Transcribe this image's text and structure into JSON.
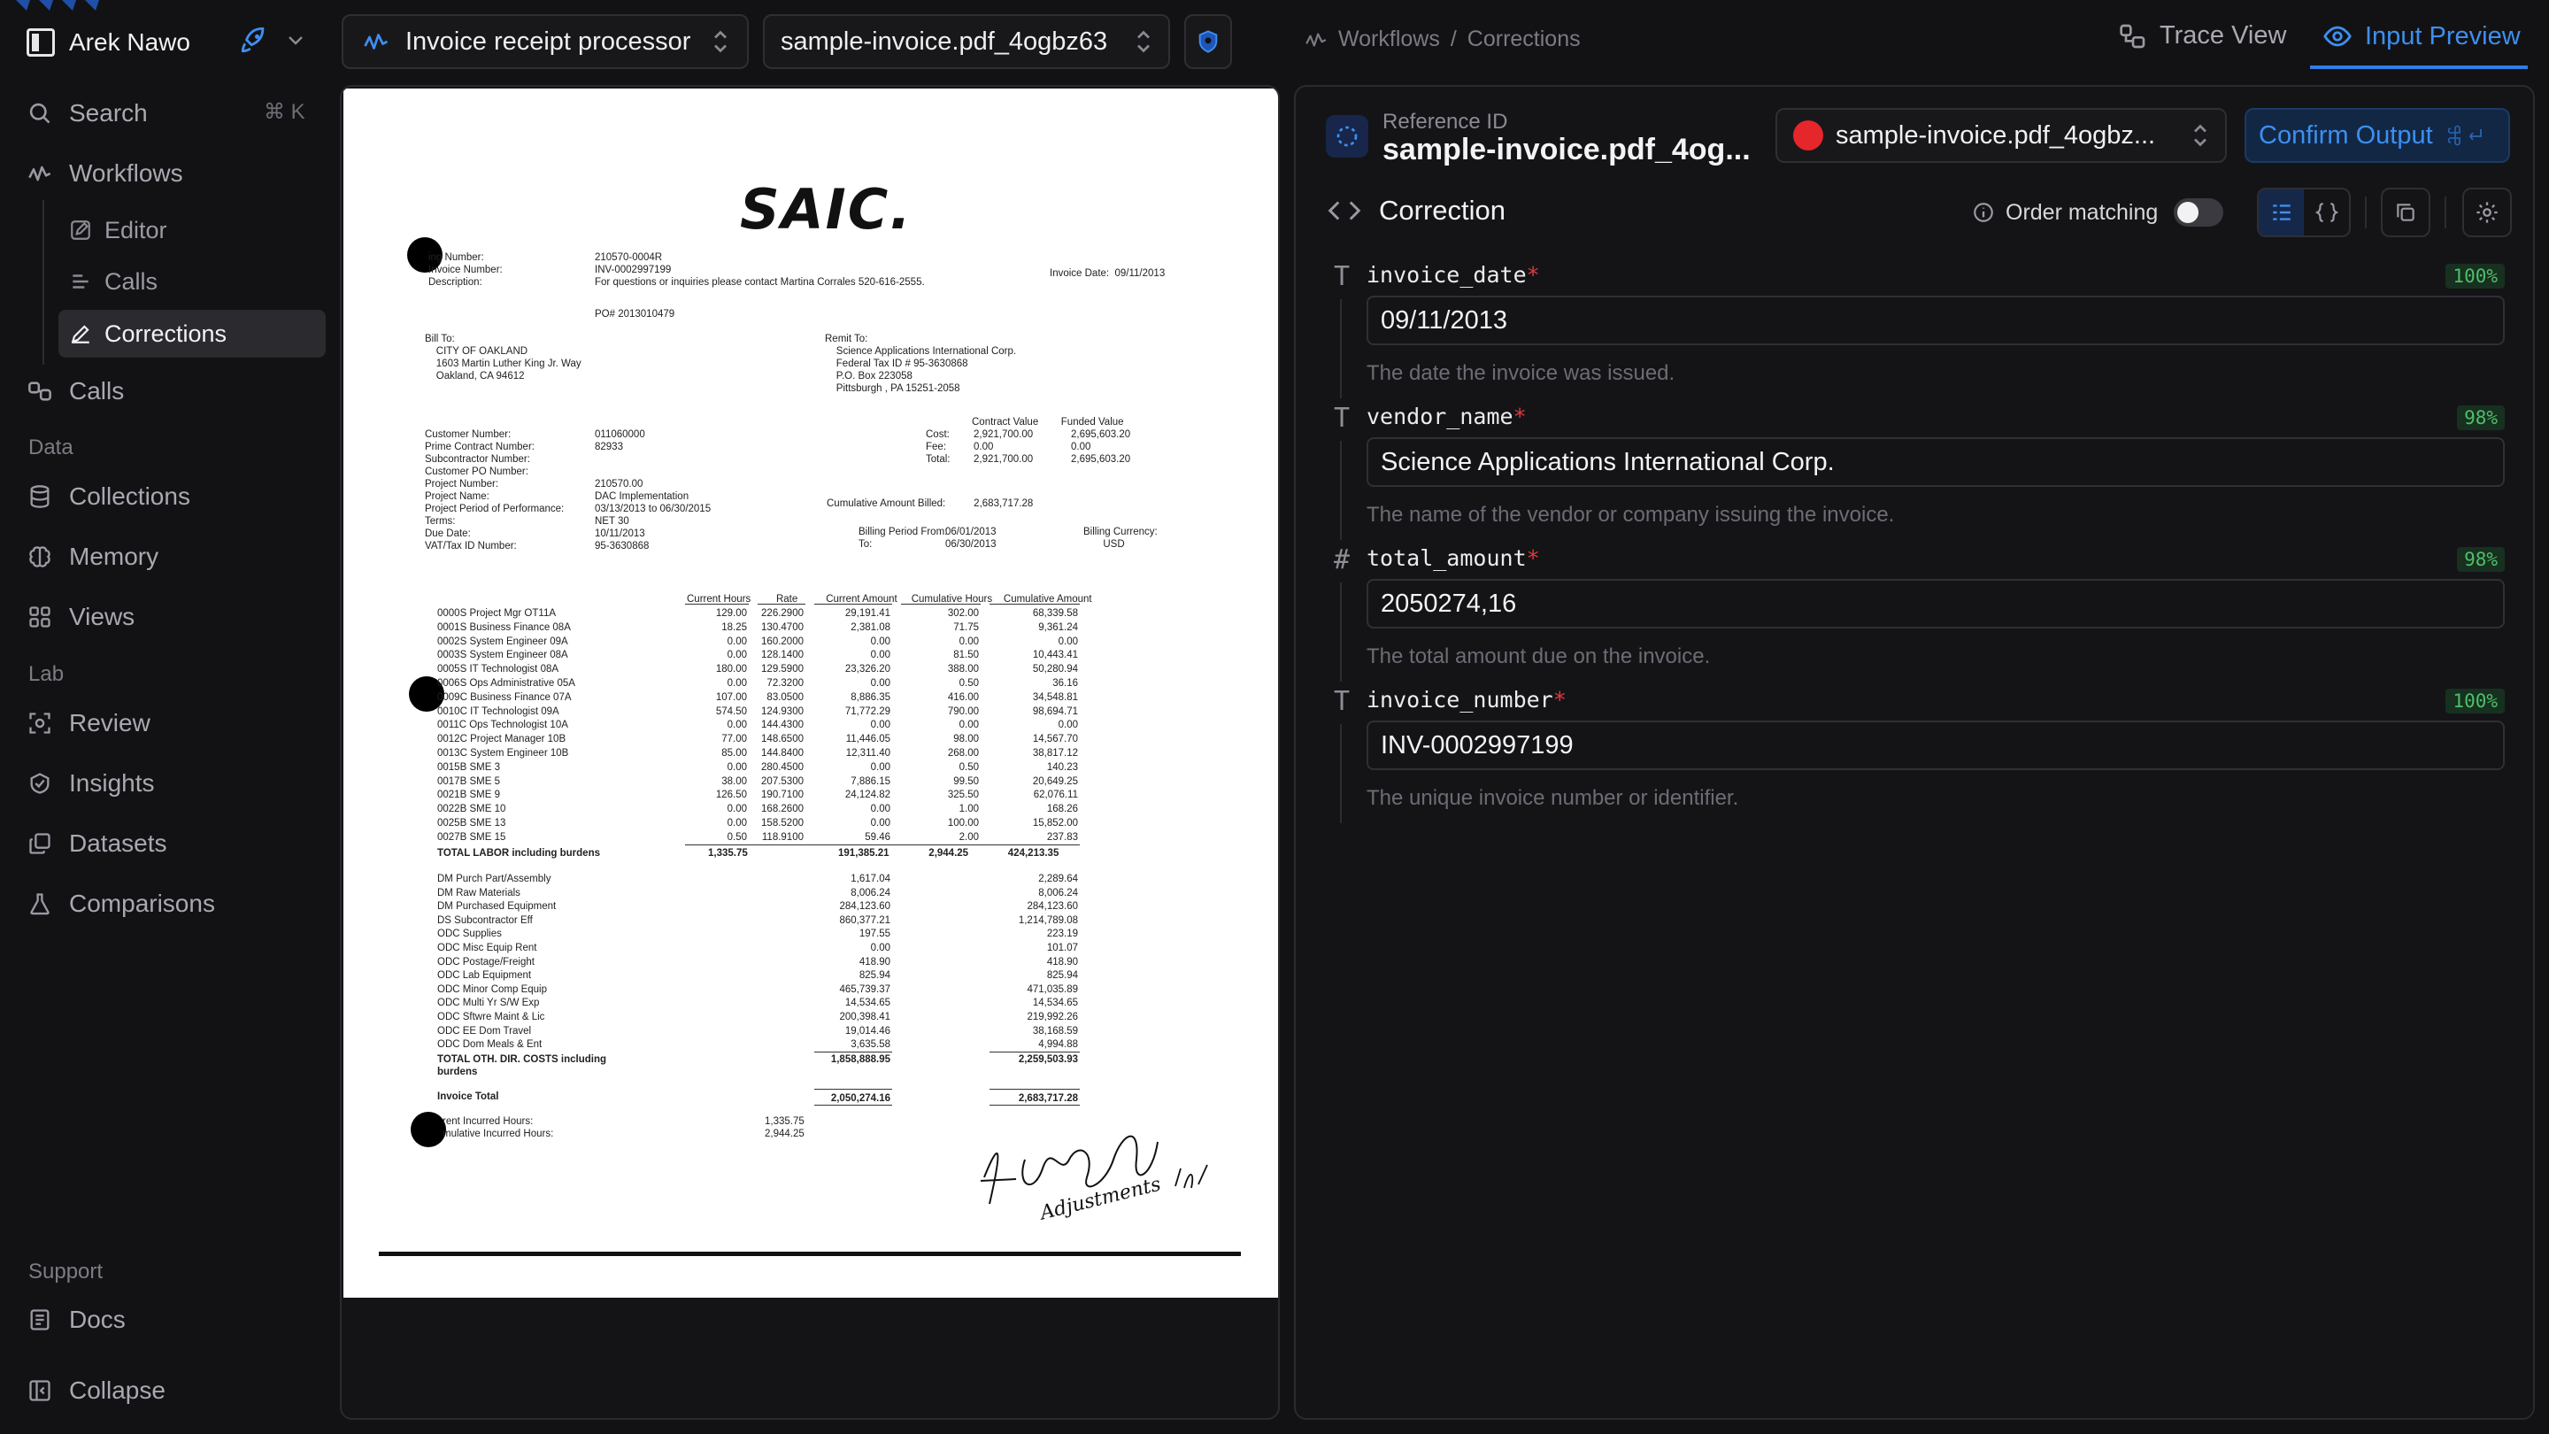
{
  "sidebar": {
    "workspace_name": "Arek Nawo",
    "search": {
      "label": "Search",
      "shortcut": "⌘ K"
    },
    "workflows_label": "Workflows",
    "workflow_items": [
      {
        "label": "Editor"
      },
      {
        "label": "Calls"
      },
      {
        "label": "Corrections"
      }
    ],
    "calls_label": "Calls",
    "data_section": "Data",
    "data_items": [
      {
        "label": "Collections"
      },
      {
        "label": "Memory"
      },
      {
        "label": "Views"
      }
    ],
    "lab_section": "Lab",
    "lab_items": [
      {
        "label": "Review"
      },
      {
        "label": "Insights"
      },
      {
        "label": "Datasets"
      },
      {
        "label": "Comparisons"
      }
    ],
    "support_section": "Support",
    "docs_label": "Docs",
    "collapse_label": "Collapse"
  },
  "topbar": {
    "processor": "Invoice receipt processor",
    "file": "sample-invoice.pdf_4ogbz63",
    "breadcrumb": [
      "Workflows",
      "/",
      "Corrections"
    ],
    "tabs": [
      {
        "label": "Trace View",
        "active": false
      },
      {
        "label": "Input Preview",
        "active": true
      }
    ]
  },
  "document": {
    "logo": "SAIC.",
    "header_labels": "ing Number:\nInvoice Number:\nDescription:",
    "header_values": "210570-0004R\nINV-0002997199\nFor questions or inquiries please contact Martina Corrales 520-616-2555.",
    "invoice_date": "Invoice Date:  09/11/2013",
    "po": "PO# 2013010479",
    "bill_to": "Bill To:\n    CITY OF OAKLAND\n    1603 Martin Luther King Jr. Way\n    Oakland, CA 94612",
    "remit_to": "Remit To:\n    Science Applications International Corp.\n    Federal Tax ID # 95-3630868\n    P.O. Box 223058\n    Pittsburgh , PA 15251-2058",
    "cust_labels": "Customer Number:\nPrime Contract Number:\nSubcontractor Number:\nCustomer PO Number:\nProject Number:\nProject Name:\nProject Period of Performance:\nTerms:\nDue Date:\nVAT/Tax ID Number:",
    "cust_values": "011060000\n82933\n\n\n210570.00\nDAC Implementation\n03/13/2013 to 06/30/2015\nNET 30\n10/11/2013\n95-3630868",
    "contract_header": "Contract Value        Funded Value",
    "contract_labels": "Cost:\nFee:\nTotal:",
    "contract_values": "2,921,700.00\n0.00\n2,921,700.00",
    "funded_values": "2,695,603.20\n0.00\n2,695,603.20",
    "cum_billed": "Cumulative Amount Billed:          2,683,717.28",
    "billing_period": "Billing Period From:\nTo:",
    "billing_dates": "06/01/2013\n06/30/2013",
    "billing_currency": "Billing Currency:\n       USD",
    "col_headers": "Current Hours         Rate          Current Amount     Cumulative Hours    Cumulative Amount",
    "labor_names": "0000S Project Mgr OT11A\n0001S Business Finance 08A\n0002S System Engineer 09A\n0003S System Engineer 08A\n0005S IT Technologist 08A\n0006S Ops Administrative 05A\n0009C Business Finance 07A\n0010C IT Technologist 09A\n0011C Ops Technologist 10A\n0012C Project Manager 10B\n0013C System Engineer 10B\n0015B SME 3\n0017B SME 5\n0021B SME 9\n0022B SME 10\n0025B SME 13\n0027B SME 15",
    "labor_hours": "129.00\n18.25\n0.00\n0.00\n180.00\n0.00\n107.00\n574.50\n0.00\n77.00\n85.00\n0.00\n38.00\n126.50\n0.00\n0.00\n0.50",
    "labor_rates": "226.2900\n130.4700\n160.2000\n128.1400\n129.5900\n72.3200\n83.0500\n124.9300\n144.4300\n148.6500\n144.8400\n280.4500\n207.5300\n190.7100\n168.2600\n158.5200\n118.9100",
    "labor_amounts": "29,191.41\n2,381.08\n0.00\n0.00\n23,326.20\n0.00\n8,886.35\n71,772.29\n0.00\n11,446.05\n12,311.40\n0.00\n7,886.15\n24,124.82\n0.00\n0.00\n59.46",
    "labor_cum_hours": "302.00\n71.75\n0.00\n81.50\n388.00\n0.50\n416.00\n790.00\n0.00\n98.00\n268.00\n0.50\n99.50\n325.50\n1.00\n100.00\n2.00",
    "labor_cum_amounts": "68,339.58\n9,361.24\n0.00\n10,443.41\n50,280.94\n36.16\n34,548.81\n98,694.71\n0.00\n14,567.70\n38,817.12\n140.23\n20,649.25\n62,076.11\n168.26\n15,852.00\n237.83",
    "labor_total_label": "TOTAL LABOR including burdens",
    "labor_total_values": "1,335.75                                191,385.21              2,944.25              424,213.35",
    "odc_names": "DM Purch Part/Assembly\nDM Raw Materials\nDM Purchased Equipment\nDS Subcontractor Eff\nODC Supplies\nODC Misc Equip Rent\nODC Postage/Freight\nODC Lab Equipment\nODC Minor Comp Equip\nODC Multi Yr S/W Exp\nODC Sftwre Maint & Lic\nODC EE Dom Travel\nODC Dom Meals & Ent",
    "odc_amounts": "1,617.04\n8,006.24\n284,123.60\n860,377.21\n197.55\n0.00\n418.90\n825.94\n465,739.37\n14,534.65\n200,398.41\n19,014.46\n3,635.58",
    "odc_cum": "2,289.64\n8,006.24\n284,123.60\n1,214,789.08\n223.19\n101.07\n418.90\n825.94\n471,035.89\n14,534.65\n219,992.26\n38,168.59\n4,994.88",
    "odc_total_label": "TOTAL OTH. DIR. COSTS including\nburdens",
    "odc_total_amount": "1,858,888.95",
    "odc_total_cum": "2,259,503.93",
    "invoice_total_label": "Invoice Total",
    "invoice_total_amount": "2,050,274.16",
    "invoice_total_cum": "2,683,717.28",
    "incurred_labels": "rent Incurred Hours:\nmulative Incurred Hours:",
    "incurred_values": "1,335.75\n2,944.25",
    "handwritten": "Adjustments"
  },
  "panel": {
    "ref_label": "Reference ID",
    "ref_value": "sample-invoice.pdf_4og...",
    "file_select": "sample-invoice.pdf_4ogbz...",
    "confirm_label": "Confirm Output",
    "correction_title": "Correction",
    "order_matching": "Order matching",
    "order_matching_on": false,
    "fields": [
      {
        "name": "invoice_date",
        "type": "T",
        "confidence": "100%",
        "value": "09/11/2013",
        "description": "The date the invoice was issued."
      },
      {
        "name": "vendor_name",
        "type": "T",
        "confidence": "98%",
        "value": "Science Applications International Corp.",
        "description": "The name of the vendor or company issuing the invoice."
      },
      {
        "name": "total_amount",
        "type": "#",
        "confidence": "98%",
        "value": "2050274,16",
        "description": "The total amount due on the invoice."
      },
      {
        "name": "invoice_number",
        "type": "T",
        "confidence": "100%",
        "value": "INV-0002997199",
        "description": "The unique invoice number or identifier."
      }
    ]
  },
  "colors": {
    "accent": "#2f7ee8",
    "confidence_bg": "#17301f",
    "confidence_text": "#4fbf6a",
    "required": "#e5383b",
    "file_dot": "#e5262b"
  }
}
